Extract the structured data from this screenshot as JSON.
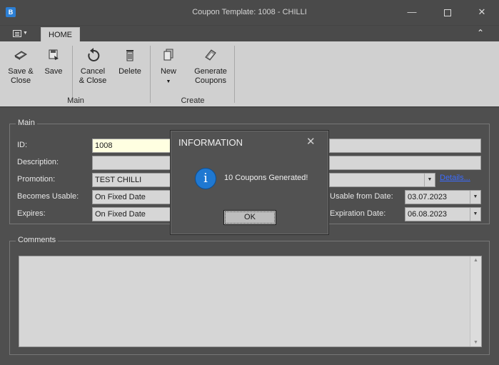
{
  "window": {
    "title": "Coupon Template: 1008 - CHILLI",
    "app_icon_glyph": "B"
  },
  "ribbon": {
    "tab_home": "HOME",
    "buttons": {
      "save_close": [
        "Save &",
        "Close"
      ],
      "save": "Save",
      "cancel_close": [
        "Cancel",
        "& Close"
      ],
      "delete": "Delete",
      "new": "New",
      "generate_coupons": [
        "Generate",
        "Coupons"
      ]
    },
    "groups": {
      "main": "Main",
      "create": "Create"
    }
  },
  "form": {
    "main_group": "Main",
    "labels": {
      "id": "ID:",
      "description": "Description:",
      "promotion": "Promotion:",
      "becomes_usable": "Becomes Usable:",
      "expires": "Expires:",
      "usable_from_date": "Usable from Date:",
      "expiration_date": "Expiration Date:"
    },
    "values": {
      "id": "1008",
      "description": "",
      "promotion": "TEST CHILLI",
      "becomes_usable": "On Fixed Date",
      "expires": "On Fixed Date",
      "usable_from_date": "03.07.2023",
      "expiration_date": "06.08.2023"
    },
    "details_link": "Details...",
    "comments_group": "Comments",
    "comments": ""
  },
  "dialog": {
    "title": "INFORMATION",
    "message": "10 Coupons Generated!",
    "ok_label": "OK",
    "icon": "info-icon"
  },
  "colors": {
    "background": "#4f4f4f",
    "ribbon": "#d0d0d0",
    "field": "#d6d6d6",
    "highlight_field": "#ffffe1",
    "link": "#3b6bff",
    "info_icon": "#1f78d1"
  }
}
